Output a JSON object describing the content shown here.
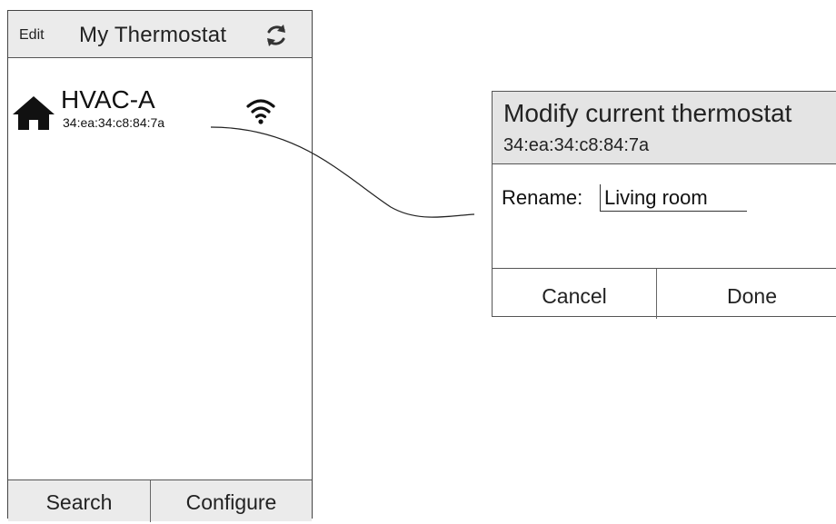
{
  "phone": {
    "edit_label": "Edit",
    "title": "My Thermostat",
    "refresh_icon": "refresh-icon",
    "devices": [
      {
        "icon": "home-icon",
        "name": "HVAC-A",
        "mac": "34:ea:34:c8:84:7a",
        "signal_icon": "wifi-icon"
      }
    ],
    "footer": {
      "search_label": "Search",
      "configure_label": "Configure"
    }
  },
  "dialog": {
    "title": "Modify current thermostat",
    "mac": "34:ea:34:c8:84:7a",
    "rename_label": "Rename:",
    "rename_value": "Living room",
    "cancel_label": "Cancel",
    "done_label": "Done"
  },
  "colors": {
    "header_bg": "#ebebeb",
    "dialog_header_bg": "#e4e4e4",
    "border": "#555555",
    "text": "#222222"
  }
}
